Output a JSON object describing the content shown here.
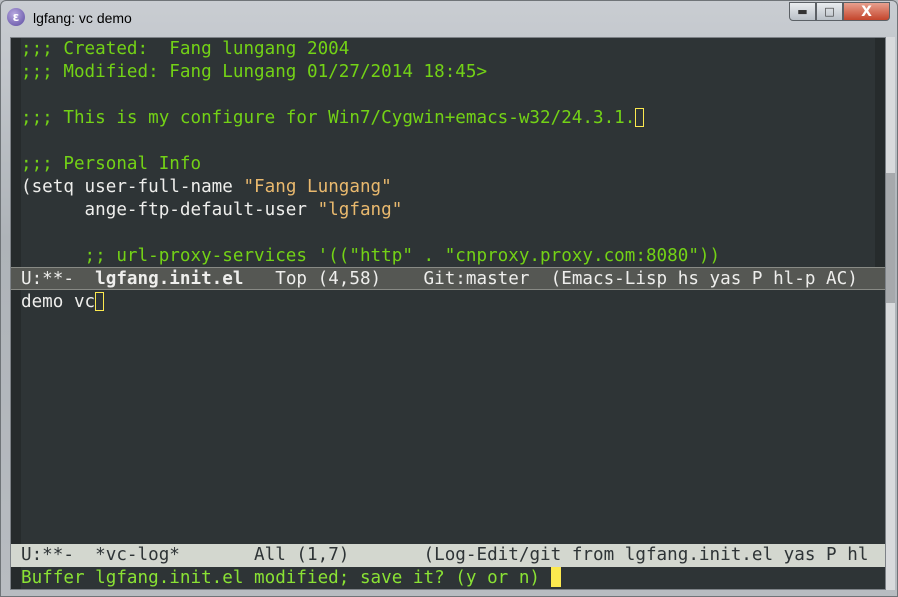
{
  "window": {
    "title": "lgfang: vc demo",
    "controls": {
      "minimize": "minimize",
      "maximize": "maximize",
      "close": "X"
    }
  },
  "upper_buffer": {
    "lines": [
      {
        "segments": [
          {
            "t": ";;; Created:  Fang lungang 2004",
            "k": "comment"
          }
        ]
      },
      {
        "segments": [
          {
            "t": ";;; Modified: Fang Lungang 01/27/2014 18:45>",
            "k": "comment"
          }
        ]
      },
      {
        "segments": []
      },
      {
        "segments": [
          {
            "t": ";;; This is my configure for Win7/Cygwin+emacs-w32/24.3.1.",
            "k": "comment"
          }
        ],
        "cursor": "box"
      },
      {
        "segments": []
      },
      {
        "segments": [
          {
            "t": ";;; Personal Info",
            "k": "comment"
          }
        ]
      },
      {
        "segments": [
          {
            "t": "(setq user-full-name ",
            "k": "default"
          },
          {
            "t": "\"Fang Lungang\"",
            "k": "string"
          }
        ]
      },
      {
        "segments": [
          {
            "t": "      ange-ftp-default-user ",
            "k": "default"
          },
          {
            "t": "\"lgfang\"",
            "k": "string"
          }
        ]
      },
      {
        "segments": []
      },
      {
        "segments": [
          {
            "t": "      ;; url-proxy-services '((\"http\" . \"cnproxy.proxy.com:8080\"))",
            "k": "comment"
          }
        ]
      }
    ]
  },
  "upper_modeline": {
    "status": "U:**-  ",
    "buffer": "lgfang.init.el",
    "position": "   Top (4,58)    Git:master  (Emacs-Lisp hs yas P hl-p AC)"
  },
  "lower_buffer": {
    "text": "demo vc"
  },
  "lower_modeline": {
    "status": "U:**-  ",
    "buffer": "*vc-log*",
    "position": "       All (1,7)       (Log-Edit/git from lgfang.init.el yas P hl"
  },
  "echo_area": {
    "text": "Buffer lgfang.init.el modified; save it? (y or n) "
  },
  "colors": {
    "background": "#2e3436",
    "comment": "#73d216",
    "string": "#e9b96e",
    "default": "#eeeeec",
    "cursor": "#fce94f",
    "echo": "#8ae234"
  }
}
